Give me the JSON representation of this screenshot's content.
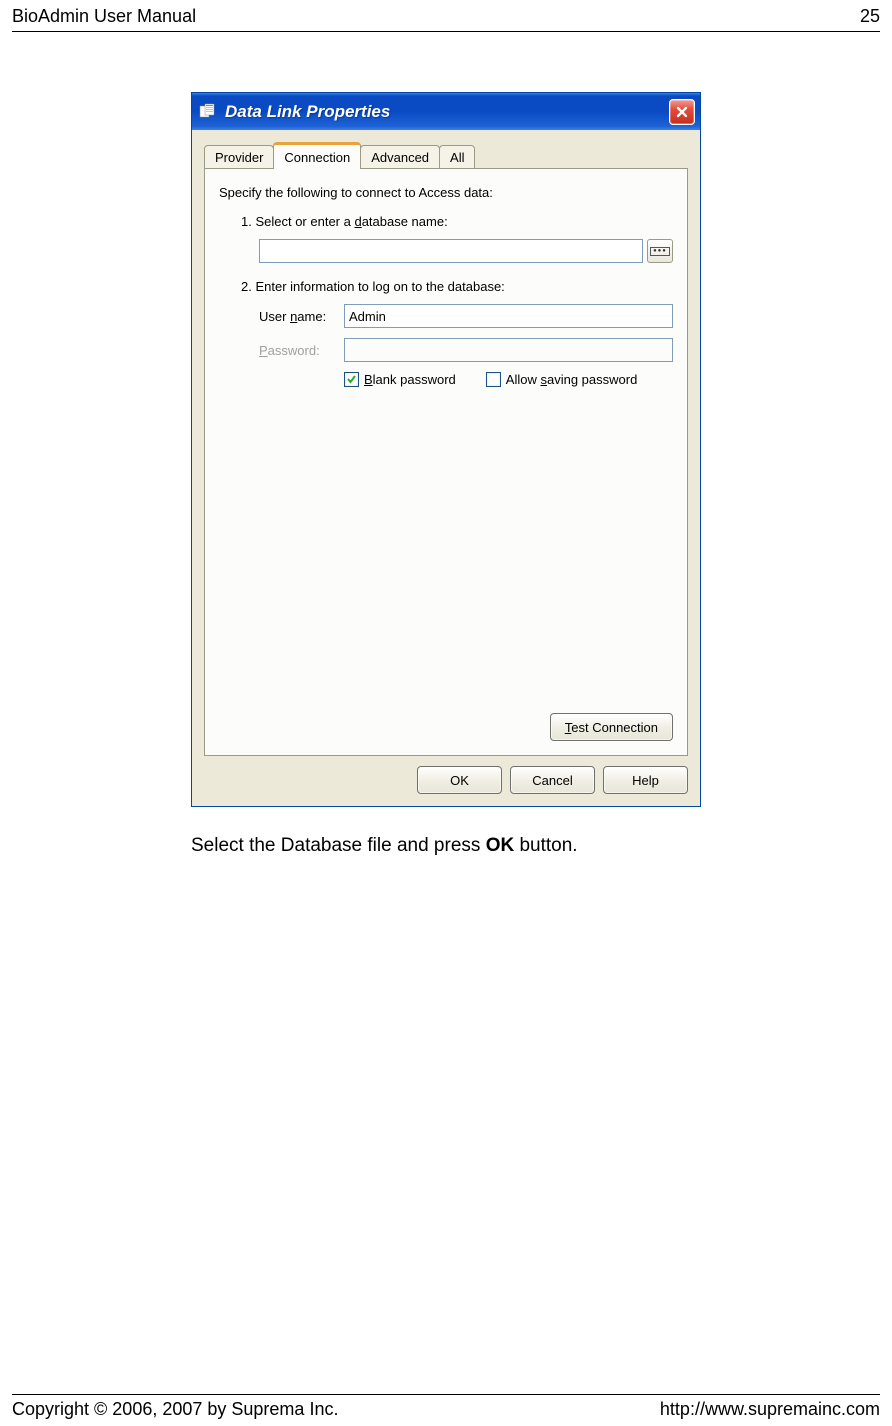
{
  "header": {
    "title": "BioAdmin User Manual",
    "page": "25"
  },
  "dialog": {
    "title": "Data Link Properties",
    "tabs": {
      "provider": "Provider",
      "connection": "Connection",
      "advanced": "Advanced",
      "all": "All"
    },
    "instruction": "Specify the following to connect to Access data:",
    "step1": "1. Select or enter a database name:",
    "db_value": "",
    "step2": "2. Enter information to log on to the database:",
    "username_label": "User name:",
    "username_value": "Admin",
    "password_label": "Password:",
    "password_value": "",
    "blank_password": "Blank password",
    "allow_saving": "Allow saving password",
    "test_connection": "Test Connection",
    "ok": "OK",
    "cancel": "Cancel",
    "help": "Help"
  },
  "caption": {
    "pre": "Select the Database file and press ",
    "bold": "OK",
    "post": " button."
  },
  "footer": {
    "copyright": "Copyright © 2006, 2007 by Suprema Inc.",
    "url": "http://www.supremainc.com"
  }
}
